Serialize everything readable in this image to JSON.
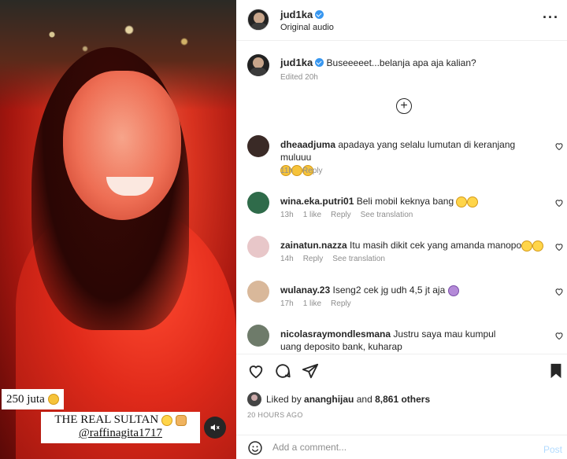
{
  "media": {
    "sticker_amount": "250 juta",
    "sticker_title": "THE REAL SULTAN",
    "sticker_tag": "@raffinagita1717",
    "mute_icon": "speaker-muted-icon"
  },
  "header": {
    "username": "jud1ka",
    "audio": "Original audio",
    "more_icon": "more-options-icon"
  },
  "caption": {
    "username": "jud1ka",
    "text": "Buseeeeet...belanja apa aja kalian?",
    "edited": "Edited",
    "time": "20h",
    "load_more_icon": "plus-circle-icon"
  },
  "comments": [
    {
      "username": "dheaadjuma",
      "text": "apadaya yang selalu lumutan di keranjang muluuu",
      "time": "11h",
      "likes": "",
      "reply": "Reply",
      "translation": "",
      "avatar_color": "#3a2a26"
    },
    {
      "username": "wina.eka.putri01",
      "text": "Beli mobil keknya bang",
      "time": "13h",
      "likes": "1 like",
      "reply": "Reply",
      "translation": "See translation",
      "avatar_color": "#2f6b4a"
    },
    {
      "username": "zainatun.nazza",
      "text": "Itu masih dikit cek yang amanda manopo",
      "time": "14h",
      "likes": "",
      "reply": "Reply",
      "translation": "See translation",
      "avatar_color": "#e8c7c9"
    },
    {
      "username": "wulanay.23",
      "text": "Iseng2 cek jg udh 4,5 jt aja",
      "time": "17h",
      "likes": "1 like",
      "reply": "Reply",
      "translation": "",
      "avatar_color": "#d9b89a"
    },
    {
      "username": "nicolasraymondlesmana",
      "text": "Justru saya mau kumpul uang deposito bank, kuharap",
      "time": "",
      "likes": "",
      "reply": "",
      "translation": "",
      "avatar_color": "#6e7b6a"
    }
  ],
  "likes": {
    "prefix": "Liked by",
    "user": "ananghijau",
    "and": "and",
    "others": "8,861 others"
  },
  "time_ago": "20 HOURS AGO",
  "add_comment": {
    "placeholder": "Add a comment...",
    "post": "Post"
  },
  "colors": {
    "verified": "#3897f0",
    "secondary_text": "#8e8e8e",
    "post_disabled": "#b3dbff"
  }
}
